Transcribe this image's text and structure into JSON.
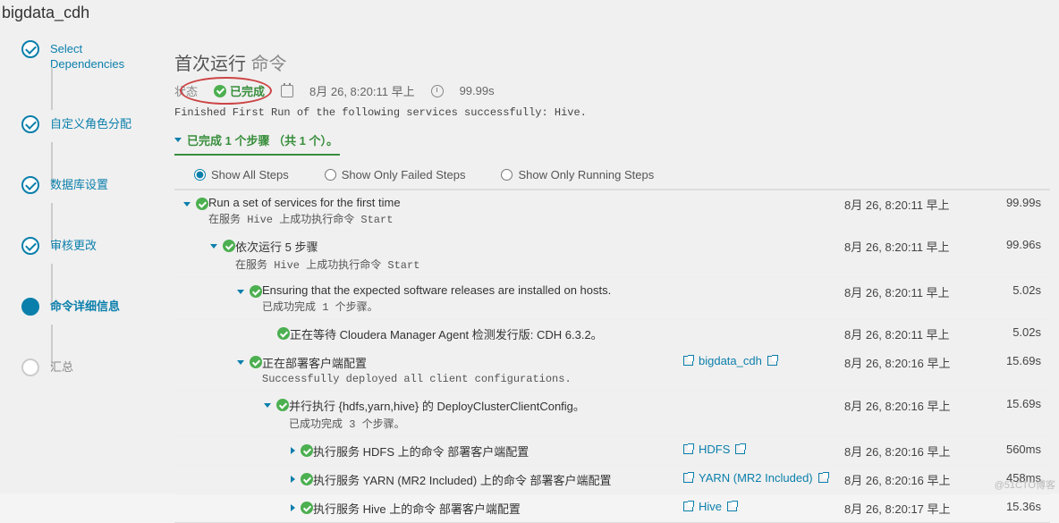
{
  "breadcrumb": "bigdata_cdh",
  "stepper": [
    {
      "label": "Select\nDependencies",
      "state": "done"
    },
    {
      "label": "自定义角色分配",
      "state": "done"
    },
    {
      "label": "数据库设置",
      "state": "done"
    },
    {
      "label": "审核更改",
      "state": "done"
    },
    {
      "label": "命令详细信息",
      "state": "current"
    },
    {
      "label": "汇总",
      "state": "pending"
    }
  ],
  "main": {
    "title_prefix": "首次运行",
    "title_cmd": "命令",
    "status_label": "状态",
    "status_value": "已完成",
    "timestamp": "8月 26, 8:20:11 早上",
    "duration": "99.99s",
    "finish_msg": "Finished First Run of the following services successfully: Hive.",
    "accordion": "已完成 1 个步骤 （共 1 个）。",
    "filters": {
      "all": "Show All Steps",
      "failed": "Show Only Failed Steps",
      "running": "Show Only Running Steps",
      "selected": "all"
    }
  },
  "rows": [
    {
      "indent": 0,
      "chev": "down",
      "ok": true,
      "title": "Run a set of services for the first time",
      "sub": "在服务 Hive 上成功执行命令 Start",
      "link": "",
      "time": "8月 26, 8:20:11 早上",
      "dur": "99.99s"
    },
    {
      "indent": 1,
      "chev": "down",
      "ok": true,
      "title": "依次运行 5 步骤",
      "sub": "在服务 Hive 上成功执行命令 Start",
      "link": "",
      "time": "8月 26, 8:20:11 早上",
      "dur": "99.96s"
    },
    {
      "indent": 2,
      "chev": "down",
      "ok": true,
      "title": "Ensuring that the expected software releases are installed on hosts.",
      "sub": "已成功完成 1 个步骤。",
      "link": "",
      "time": "8月 26, 8:20:11 早上",
      "dur": "5.02s"
    },
    {
      "indent": 3,
      "chev": "",
      "ok": true,
      "title": "正在等待 Cloudera Manager Agent 检测发行版: CDH 6.3.2。",
      "sub": "",
      "link": "",
      "time": "8月 26, 8:20:11 早上",
      "dur": "5.02s"
    },
    {
      "indent": 2,
      "chev": "down",
      "ok": true,
      "title": "正在部署客户端配置",
      "sub": "Successfully deployed all client configurations.",
      "link": "bigdata_cdh",
      "time": "8月 26, 8:20:16 早上",
      "dur": "15.69s"
    },
    {
      "indent": 3,
      "chev": "down",
      "ok": true,
      "title": "并行执行 {hdfs,yarn,hive} 的 DeployClusterClientConfig。",
      "sub": "已成功完成 3 个步骤。",
      "link": "",
      "time": "8月 26, 8:20:16 早上",
      "dur": "15.69s"
    },
    {
      "indent": 4,
      "chev": "right",
      "ok": true,
      "title": "执行服务 HDFS 上的命令 部署客户端配置",
      "sub": "",
      "link": "HDFS",
      "time": "8月 26, 8:20:16 早上",
      "dur": "560ms"
    },
    {
      "indent": 4,
      "chev": "right",
      "ok": true,
      "title": "执行服务 YARN (MR2 Included) 上的命令 部署客户端配置",
      "sub": "",
      "link": "YARN (MR2 Included)",
      "time": "8月 26, 8:20:16 早上",
      "dur": "458ms"
    },
    {
      "indent": 4,
      "chev": "right",
      "ok": true,
      "title": "执行服务 Hive 上的命令 部署客户端配置",
      "sub": "",
      "link": "Hive",
      "time": "8月 26, 8:20:17 早上",
      "dur": "15.36s"
    }
  ],
  "watermark": "@51CTO博客"
}
